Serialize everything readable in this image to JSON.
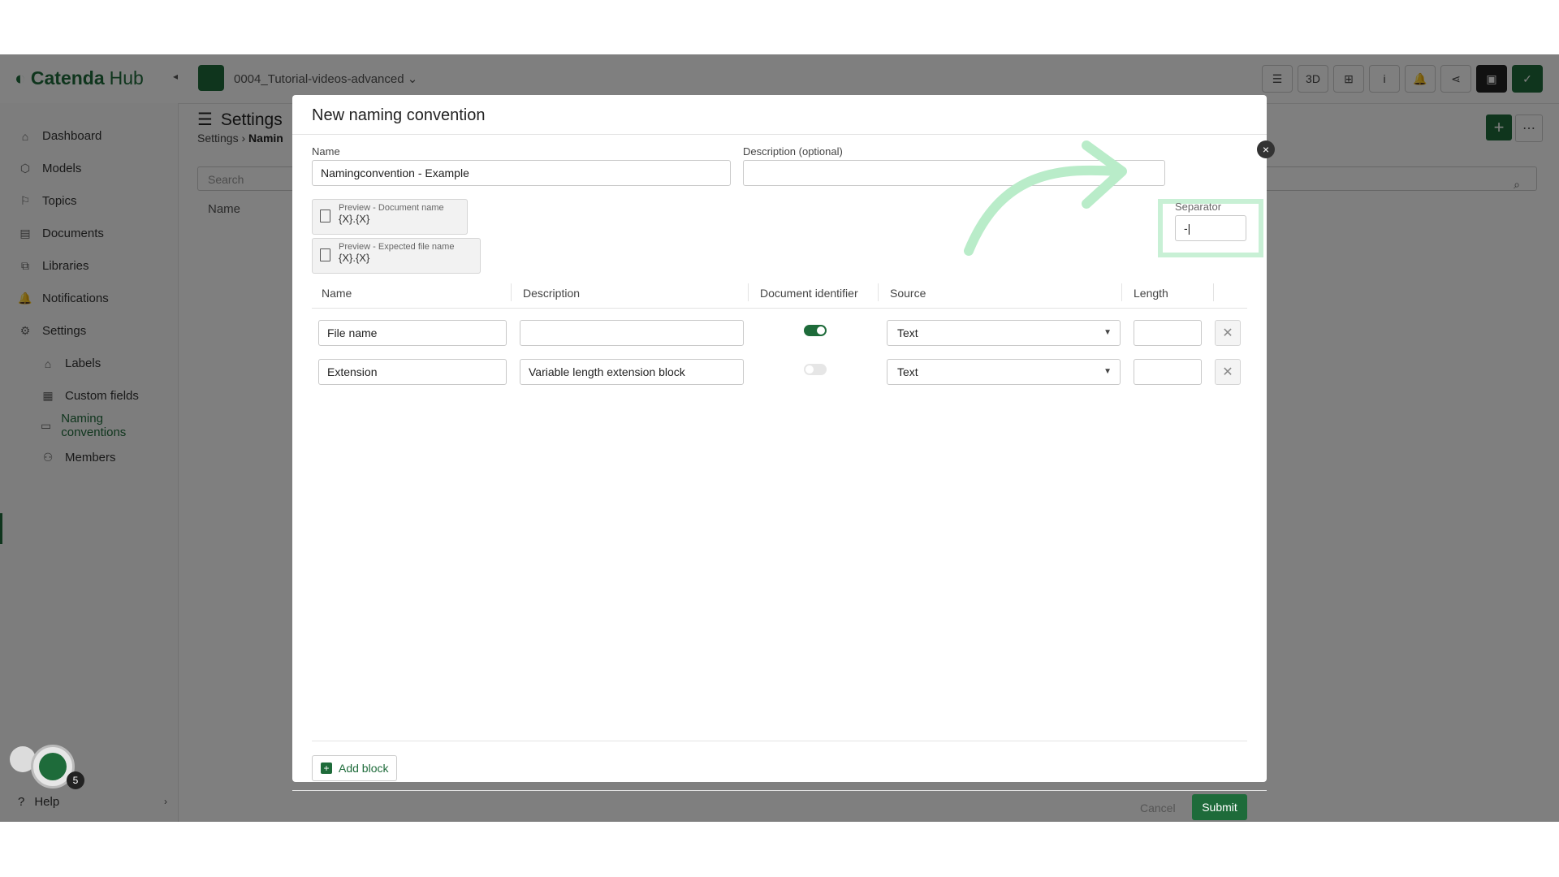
{
  "app": {
    "logo_brand": "Catenda",
    "logo_hub": "Hub",
    "project_name": "0004_Tutorial-videos-advanced",
    "collapse_icon": "◂"
  },
  "toolbar": {
    "list_view": "☰",
    "view_3d": "3D",
    "tree_view": "⊞",
    "info": "i",
    "bell": "🔔",
    "share": "⋖",
    "chat": "▣",
    "avatar": "✓"
  },
  "sidebar": {
    "items": [
      {
        "label": "Dashboard",
        "icon": "⌂"
      },
      {
        "label": "Models",
        "icon": "⬡"
      },
      {
        "label": "Topics",
        "icon": "⚐"
      },
      {
        "label": "Documents",
        "icon": "▤"
      },
      {
        "label": "Libraries",
        "icon": "⧉"
      },
      {
        "label": "Notifications",
        "icon": "🔔"
      },
      {
        "label": "Settings",
        "icon": "⚙"
      }
    ],
    "sub_items": [
      {
        "label": "Labels",
        "icon": "⌂"
      },
      {
        "label": "Custom fields",
        "icon": "▦"
      },
      {
        "label": "Naming conventions",
        "icon": "▭"
      },
      {
        "label": "Members",
        "icon": "⚇"
      }
    ],
    "help": "Help",
    "badge": "5"
  },
  "page": {
    "title": "Settings",
    "crumb_root": "Settings",
    "crumb_sep": "›",
    "crumb_current": "Namin",
    "search_placeholder": "Search",
    "col_name": "Name"
  },
  "modal": {
    "title": "New naming convention",
    "name_label": "Name",
    "name_value": "Namingconvention - Example",
    "desc_label": "Description (optional)",
    "desc_value": "",
    "separator_label": "Separator",
    "separator_value": "-|",
    "preview_doc_label": "Preview - Document name",
    "preview_doc_value": "{X}.{X}",
    "preview_file_label": "Preview - Expected file name",
    "preview_file_value": "{X}.{X}",
    "columns": [
      "Name",
      "Description",
      "Document identifier",
      "Source",
      "Length"
    ],
    "rows": [
      {
        "name": "File name",
        "description": "",
        "identifier_on": true,
        "source": "Text",
        "length": ""
      },
      {
        "name": "Extension",
        "description": "Variable length extension block",
        "identifier_on": false,
        "source": "Text",
        "length": ""
      }
    ],
    "add_block": "Add block",
    "cancel": "Cancel",
    "submit": "Submit",
    "close": "×"
  },
  "colors": {
    "brand": "#1e6b3a",
    "highlight": "#c8f0d5"
  }
}
